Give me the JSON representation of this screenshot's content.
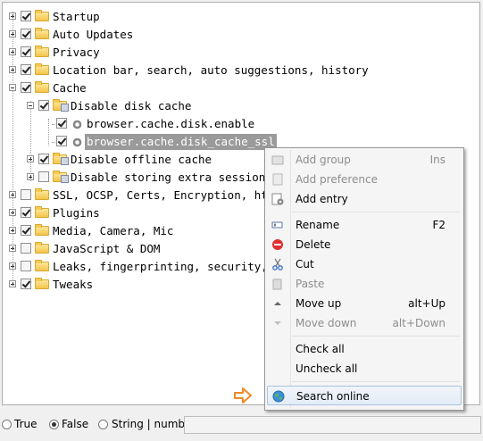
{
  "tree": {
    "items": [
      {
        "label": "Startup",
        "checked": true
      },
      {
        "label": "Auto Updates",
        "checked": true
      },
      {
        "label": "Privacy",
        "checked": true
      },
      {
        "label": "Location bar, search, auto suggestions, history",
        "checked": true
      },
      {
        "label": "Cache",
        "checked": true
      },
      {
        "label": "Disable disk cache",
        "checked": true
      },
      {
        "label": "browser.cache.disk.enable",
        "checked": true
      },
      {
        "label": "browser.cache.disk_cache_ssl",
        "checked": true
      },
      {
        "label": "Disable offline cache",
        "checked": true
      },
      {
        "label": "Disable storing extra session da",
        "checked": false
      },
      {
        "label": "SSL, OCSP, Certs, Encryption, http",
        "checked": false
      },
      {
        "label": "Plugins",
        "checked": true
      },
      {
        "label": "Media, Camera, Mic",
        "checked": true
      },
      {
        "label": "JavaScript & DOM",
        "checked": false
      },
      {
        "label": "Leaks, fingerprinting, security, d",
        "checked": false
      },
      {
        "label": "Tweaks",
        "checked": true
      }
    ]
  },
  "context_menu": {
    "add_group": {
      "label": "Add group",
      "shortcut": "Ins"
    },
    "add_preference": {
      "label": "Add preference"
    },
    "add_entry": {
      "label": "Add entry"
    },
    "rename": {
      "label": "Rename",
      "shortcut": "F2"
    },
    "delete": {
      "label": "Delete"
    },
    "cut": {
      "label": "Cut"
    },
    "paste": {
      "label": "Paste"
    },
    "move_up": {
      "label": "Move up",
      "shortcut": "alt+Up"
    },
    "move_down": {
      "label": "Move down",
      "shortcut": "alt+Down"
    },
    "check_all": {
      "label": "Check all"
    },
    "uncheck_all": {
      "label": "Uncheck all"
    },
    "search_online": {
      "label": "Search online"
    }
  },
  "value_bar": {
    "true_label": "True",
    "false_label": "False",
    "string_label": "String | number:",
    "selected": "False",
    "value": ""
  },
  "colors": {
    "accent_arrow": "#f08a24",
    "selection": "#9a9a9a"
  }
}
